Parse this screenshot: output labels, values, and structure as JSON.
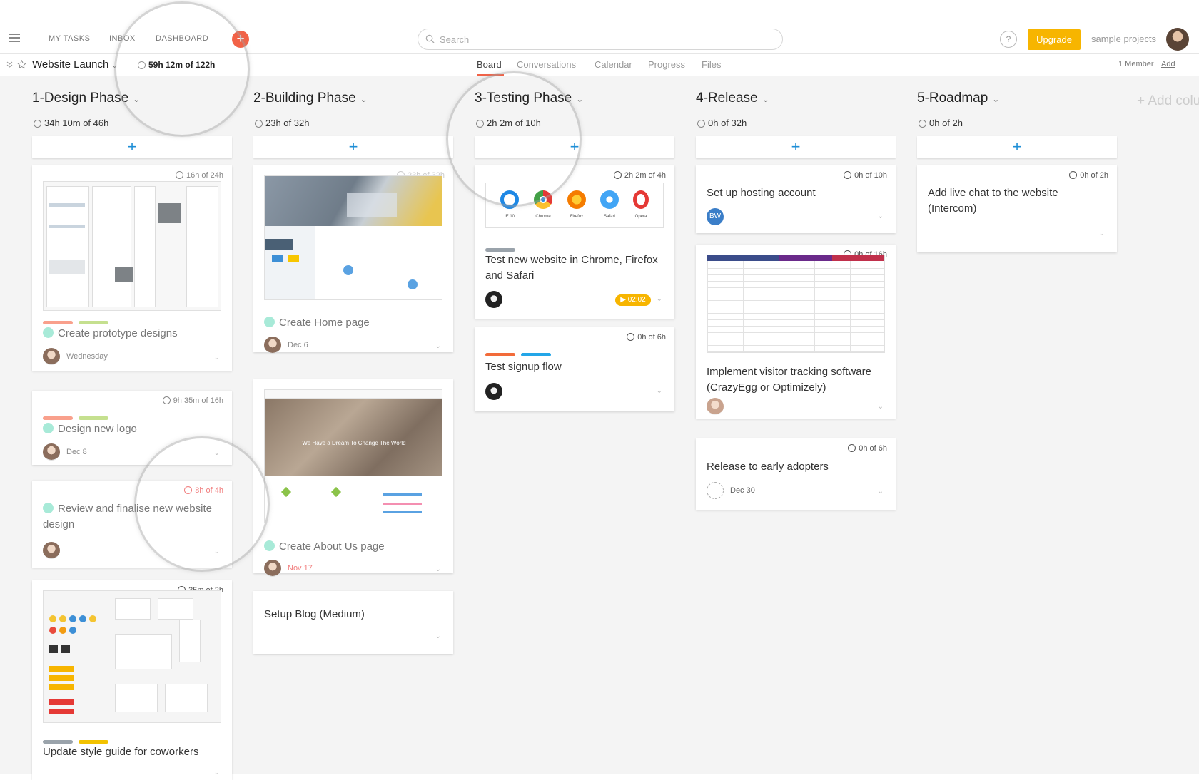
{
  "topnav": {
    "my_tasks": "MY TASKS",
    "inbox": "INBOX",
    "dashboard": "DASHBOARD",
    "add": "+",
    "search_placeholder": "Search",
    "help": "?",
    "upgrade": "Upgrade",
    "project_name": "sample projects"
  },
  "project": {
    "title": "Website Launch",
    "time": "59h 12m of 122h",
    "tabs": [
      "Board",
      "Conversations",
      "Calendar",
      "Progress",
      "Files"
    ],
    "active_tab": "Board",
    "members": "1 Member",
    "add": "Add"
  },
  "board": {
    "add_column": "+ Add colu",
    "columns": [
      {
        "name": "1-Design Phase",
        "time": "34h 10m of 46h",
        "cards": [
          {
            "title": "Create prototype designs",
            "estimate": "16h of 24h",
            "due": "Wednesday",
            "done": true
          },
          {
            "title": "Design new logo",
            "estimate": "9h 35m of 16h",
            "due": "Dec 8",
            "done": true
          },
          {
            "title": "Review and finalise new website design",
            "estimate": "8h of 4h",
            "done": true
          },
          {
            "title": "Update style guide for coworkers",
            "estimate": "35m of 2h",
            "done": false
          }
        ]
      },
      {
        "name": "2-Building Phase",
        "time": "23h of 32h",
        "cards": [
          {
            "title": "Create Home page",
            "estimate": "23h of 32h",
            "due": "Dec 6",
            "done": true
          },
          {
            "title": "Create About Us page",
            "due": "Nov 17",
            "done": true,
            "thumb_headline": "We Have a Dream To Change The World"
          },
          {
            "title": "Setup Blog (Medium)",
            "done": false
          }
        ]
      },
      {
        "name": "3-Testing Phase",
        "time": "2h 2m of 10h",
        "cards": [
          {
            "title": "Test new website in Chrome, Firefox and Safari",
            "estimate": "2h 2m of 4h",
            "timer": "02:02",
            "browsers": [
              "IE 10",
              "Chrome",
              "Firefox",
              "Safari",
              "Opera"
            ]
          },
          {
            "title": "Test signup flow",
            "estimate": "0h of 6h"
          }
        ]
      },
      {
        "name": "4-Release",
        "time": "0h of 32h",
        "cards": [
          {
            "title": "Set up hosting account",
            "estimate": "0h of 10h",
            "assignee": "BW"
          },
          {
            "title": "Implement visitor tracking software (CrazyEgg or Optimizely)",
            "estimate": "0h of 16h"
          },
          {
            "title": "Release to early adopters",
            "estimate": "0h of 6h",
            "due": "Dec 30"
          }
        ]
      },
      {
        "name": "5-Roadmap",
        "time": "0h of 2h",
        "cards": [
          {
            "title": "Add live chat to the website (Intercom)",
            "estimate": "0h of 2h"
          }
        ]
      }
    ]
  },
  "colors": {
    "accent": "#f26247",
    "upgrade": "#f7b500",
    "link_blue": "#1e8ed6",
    "tag_salmon": "#f9a08c",
    "tag_green": "#c5e08f",
    "tag_grey": "#9aa3ab",
    "tag_yellow": "#f2c200",
    "tag_orange": "#f26b3a",
    "tag_blue": "#23a6e8",
    "check": "#a8ead8"
  }
}
